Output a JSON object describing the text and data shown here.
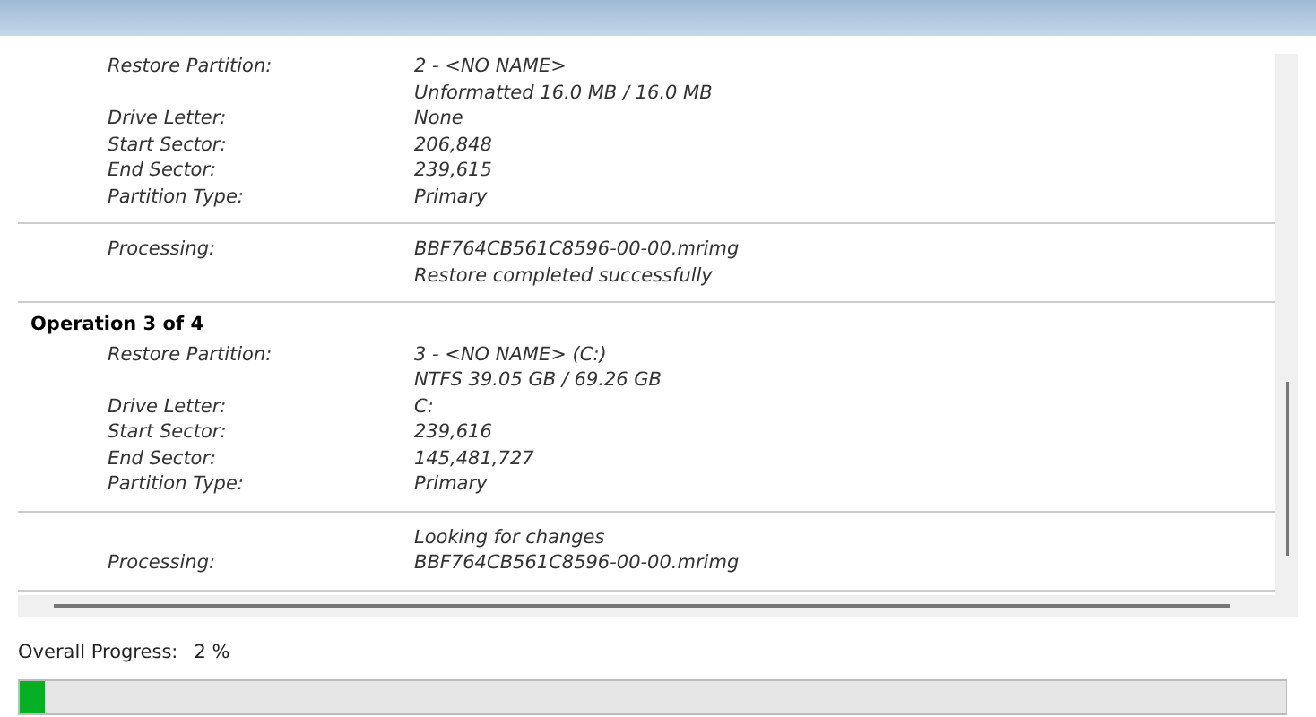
{
  "operations": [
    {
      "details": [
        {
          "label": "Restore Partition:",
          "values": [
            "2 - <NO NAME>",
            "Unformatted 16.0 MB / 16.0 MB"
          ]
        },
        {
          "label": "Drive Letter:",
          "values": [
            "None"
          ]
        },
        {
          "label": "Start Sector:",
          "values": [
            "206,848"
          ]
        },
        {
          "label": "End Sector:",
          "values": [
            "239,615"
          ]
        },
        {
          "label": "Partition Type:",
          "values": [
            "Primary"
          ]
        }
      ],
      "processing": {
        "label": "Processing:",
        "lines": [
          {
            "kind": "file",
            "text": "BBF764CB561C8596-00-00.mrimg"
          },
          {
            "kind": "status",
            "text": "Restore completed successfully"
          }
        ]
      }
    },
    {
      "title": "Operation 3 of 4",
      "details": [
        {
          "label": "Restore Partition:",
          "values": [
            "3 - <NO NAME> (C:)",
            "NTFS 39.05 GB / 69.26 GB"
          ]
        },
        {
          "label": "Drive Letter:",
          "values": [
            "C:"
          ]
        },
        {
          "label": "Start Sector:",
          "values": [
            "239,616"
          ]
        },
        {
          "label": "End Sector:",
          "values": [
            "145,481,727"
          ]
        },
        {
          "label": "Partition Type:",
          "values": [
            "Primary"
          ]
        }
      ],
      "processing": {
        "label": "Processing:",
        "lines": [
          {
            "kind": "status",
            "text": "Looking for changes"
          },
          {
            "kind": "file",
            "text": "BBF764CB561C8596-00-00.mrimg"
          }
        ]
      }
    }
  ],
  "overall_progress": {
    "label": "Overall Progress:",
    "reading": "2 %",
    "level": 0.02
  }
}
